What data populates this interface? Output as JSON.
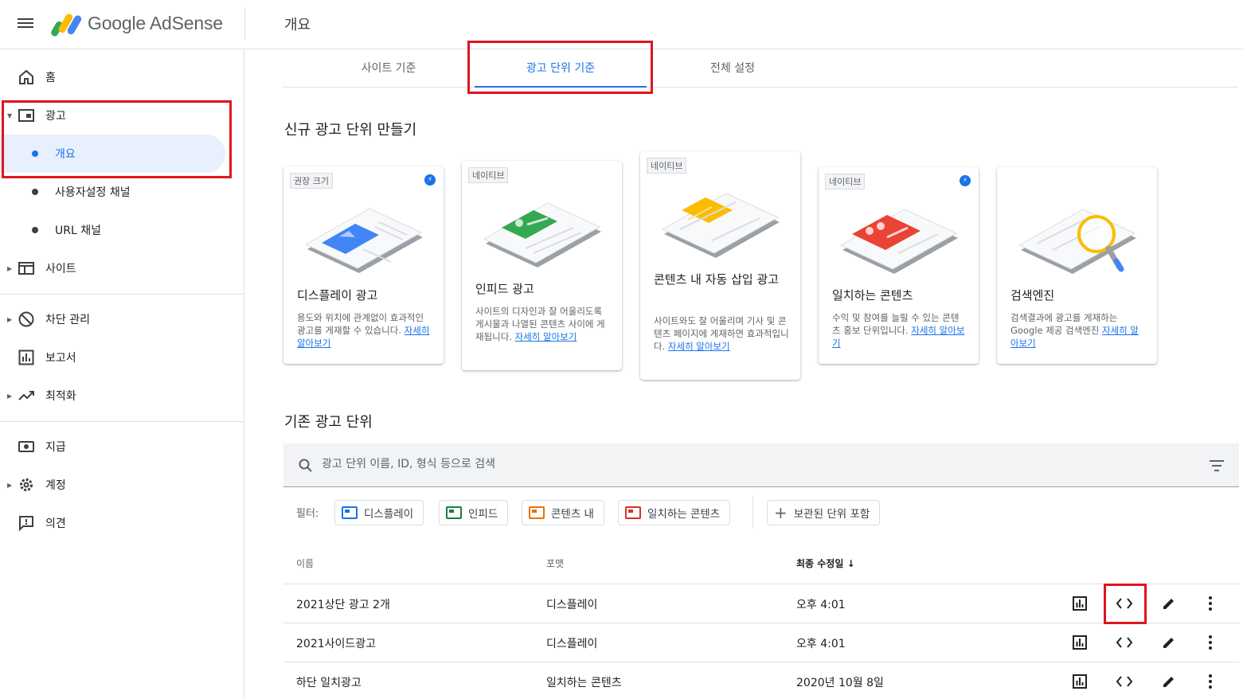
{
  "header": {
    "brand": "Google AdSense",
    "page_title": "개요"
  },
  "sidebar": {
    "items": [
      {
        "label": "홈",
        "icon": "home-icon"
      },
      {
        "label": "광고",
        "icon": "ads-icon"
      },
      {
        "label": "개요"
      },
      {
        "label": "사용자설정 채널"
      },
      {
        "label": "URL 채널"
      },
      {
        "label": "사이트",
        "icon": "sites-icon"
      },
      {
        "label": "차단 관리",
        "icon": "block-icon"
      },
      {
        "label": "보고서",
        "icon": "reports-icon"
      },
      {
        "label": "최적화",
        "icon": "trending-icon"
      },
      {
        "label": "지급",
        "icon": "payments-icon"
      },
      {
        "label": "계정",
        "icon": "gear-icon"
      },
      {
        "label": "의견",
        "icon": "feedback-icon"
      }
    ]
  },
  "tabs": [
    {
      "label": "사이트 기준"
    },
    {
      "label": "광고 단위 기준"
    },
    {
      "label": "전체 설정"
    }
  ],
  "create": {
    "title": "신규 광고 단위 만들기",
    "cards": [
      {
        "chip": "권장 크기",
        "title": "디스플레이 광고",
        "desc": "용도와 위치에 관계없이 효과적인 광고를 게재할 수 있습니다.",
        "link": "자세히 알아보기"
      },
      {
        "chip": "네이티브",
        "title": "인피드 광고",
        "desc": "사이트의 디자인과 잘 어울리도록 게시물과 나열된 콘텐츠 사이에 게재됩니다.",
        "link": "자세히 알아보기"
      },
      {
        "chip": "네이티브",
        "title": "콘텐츠 내 자동 삽입 광고",
        "desc": "사이트와도 잘 어울리며 기사 및 콘텐츠 페이지에 게재하면 효과적입니다.",
        "link": "자세히 알아보기"
      },
      {
        "chip": "네이티브",
        "title": "일치하는 콘텐츠",
        "desc": "수익 및 참여를 늘릴 수 있는 콘텐츠 홍보 단위입니다.",
        "link": "자세히 알아보기"
      },
      {
        "chip": "",
        "title": "검색엔진",
        "desc": "검색결과에 광고를 게재하는 Google 제공 검색엔진",
        "link": "자세히 알아보기"
      }
    ]
  },
  "existing": {
    "title": "기존 광고 단위",
    "search_placeholder": "광고 단위 이름, ID, 형식 등으로 검색",
    "filter_label": "필터:",
    "filters": [
      {
        "label": "디스플레이",
        "color": "#1a73e8"
      },
      {
        "label": "인피드",
        "color": "#188038"
      },
      {
        "label": "콘텐츠 내",
        "color": "#e37400"
      },
      {
        "label": "일치하는 콘텐츠",
        "color": "#d93025"
      }
    ],
    "archived_label": "보관된 단위 포함",
    "columns": {
      "name": "이름",
      "format": "포맷",
      "modified": "최종 수정일"
    },
    "rows": [
      {
        "name": "2021상단 광고 2개",
        "format": "디스플레이",
        "modified": "오후 4:01"
      },
      {
        "name": "2021사이드광고",
        "format": "디스플레이",
        "modified": "오후 4:01"
      },
      {
        "name": "하단 일치광고",
        "format": "일치하는 콘텐츠",
        "modified": "2020년 10월 8일"
      }
    ]
  },
  "colors": {
    "accent": "#1a73e8",
    "highlight": "#e0141e",
    "active_bg": "#e8f0fe"
  }
}
